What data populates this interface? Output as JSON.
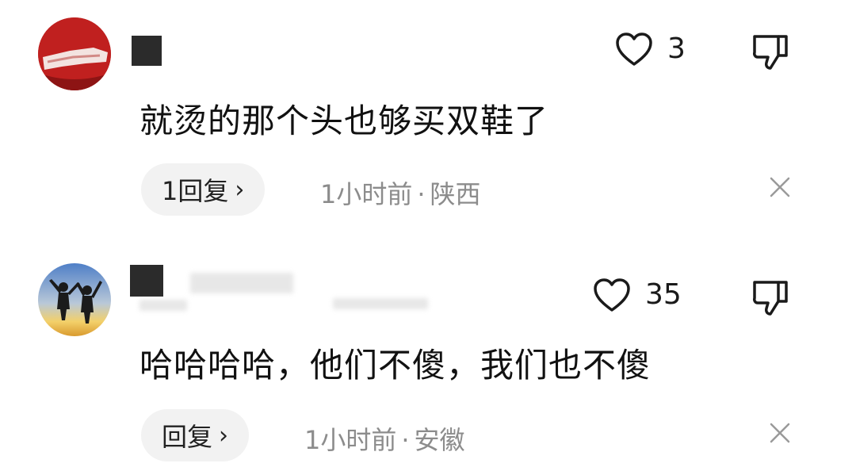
{
  "comments": [
    {
      "avatar_icon": "red-banner-avatar-icon",
      "like_count": "3",
      "text": "就烫的那个头也够买双鞋了",
      "reply_label": "1回复",
      "time": "1小时前",
      "separator": "·",
      "location": "陕西"
    },
    {
      "avatar_icon": "silhouette-jumping-avatar-icon",
      "like_count": "35",
      "text": "哈哈哈哈，他们不傻，我们也不傻",
      "reply_label": "回复",
      "time": "1小时前",
      "separator": "·",
      "location": "安徽"
    }
  ],
  "icons": {
    "like": "heart-outline-icon",
    "dislike": "thumbs-down-icon",
    "close": "close-icon",
    "chevron": "chevron-right-icon"
  },
  "colors": {
    "text": "#111111",
    "meta": "#8c8c8c",
    "pill_bg": "#f2f2f2"
  }
}
